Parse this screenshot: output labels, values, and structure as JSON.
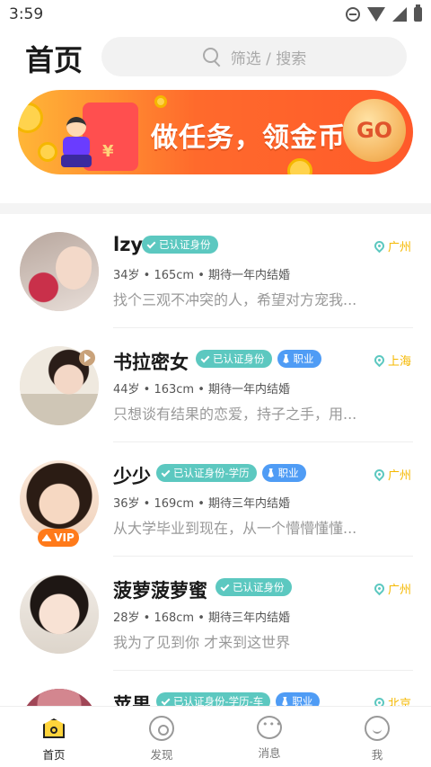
{
  "status_bar": {
    "time": "3:59"
  },
  "header": {
    "title": "首页",
    "search_placeholder": "筛选 / 搜索"
  },
  "banner": {
    "text": "做任务，领金币",
    "go_label": "GO"
  },
  "profiles": [
    {
      "name": "lzy",
      "verify": "已认证身份",
      "job": "",
      "location": "广州",
      "meta": "34岁 • 165cm • 期待一年内结婚",
      "desc": "找个三观不冲突的人，希望对方宠我...",
      "vip": false,
      "video": false
    },
    {
      "name": "书拉密女",
      "verify": "已认证身份",
      "job": "职业",
      "location": "上海",
      "meta": "44岁 • 163cm • 期待一年内结婚",
      "desc": "只想谈有结果的恋爱，持子之手，用...",
      "vip": false,
      "video": true
    },
    {
      "name": "少少",
      "verify": "已认证身份-学历",
      "job": "职业",
      "location": "广州",
      "meta": "36岁 • 169cm • 期待三年内结婚",
      "desc": "从大学毕业到现在，从一个懵懵懂懂...",
      "vip": true,
      "video": false
    },
    {
      "name": "菠萝菠萝蜜",
      "verify": "已认证身份",
      "job": "",
      "location": "广州",
      "meta": "28岁 • 168cm • 期待三年内结婚",
      "desc": "我为了见到你 才来到这世界",
      "vip": false,
      "video": false
    },
    {
      "name": "苹果",
      "verify": "已认证身份-学历-车",
      "job": "职业",
      "location": "北京",
      "meta": "",
      "desc": "",
      "vip": false,
      "video": false
    }
  ],
  "vip_label": "VIP",
  "nav": [
    {
      "label": "首页",
      "icon": "home-icon",
      "active": true
    },
    {
      "label": "发现",
      "icon": "discover-icon",
      "active": false
    },
    {
      "label": "消息",
      "icon": "message-icon",
      "active": false
    },
    {
      "label": "我",
      "icon": "profile-icon",
      "active": false
    }
  ],
  "colors": {
    "accent_yellow": "#ffd43b",
    "verify_teal": "#5cc8c0",
    "job_blue": "#4f9cf5",
    "location_gold": "#f5b800",
    "banner_orange": "#ff6a2c",
    "vip_orange": "#ff7a1a"
  }
}
